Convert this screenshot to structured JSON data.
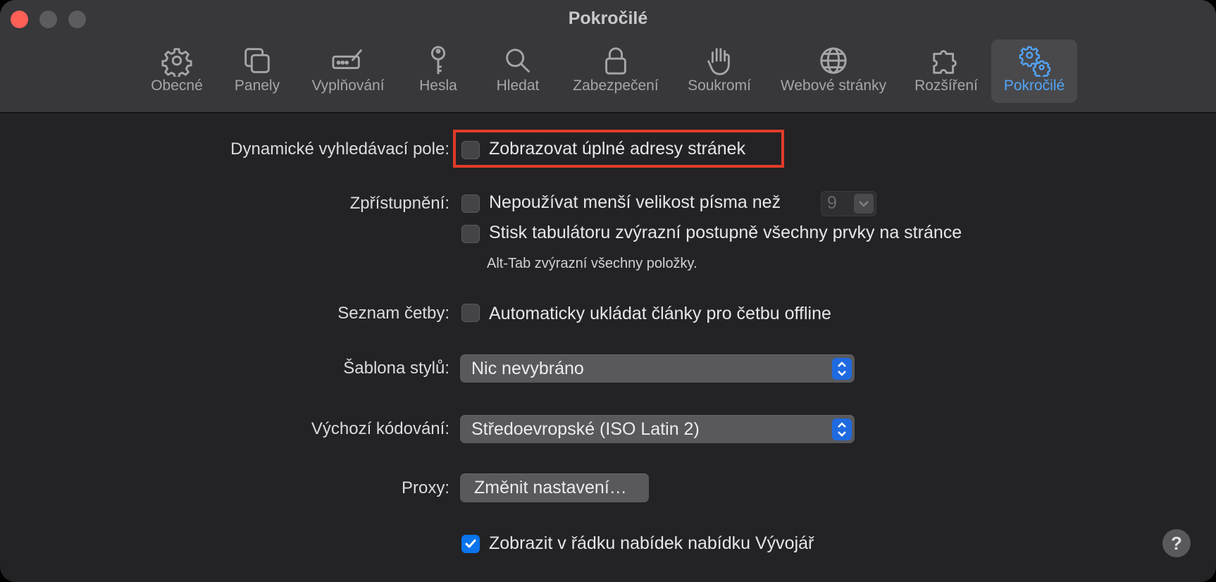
{
  "window": {
    "title": "Pokročilé",
    "accent_color": "#53a4f8",
    "highlight_color": "#e03c28"
  },
  "toolbar": {
    "items": [
      {
        "label": "Obecné",
        "icon": "gear-icon"
      },
      {
        "label": "Panely",
        "icon": "tabs-icon"
      },
      {
        "label": "Vyplňování",
        "icon": "autofill-icon"
      },
      {
        "label": "Hesla",
        "icon": "key-icon"
      },
      {
        "label": "Hledat",
        "icon": "search-icon"
      },
      {
        "label": "Zabezpečení",
        "icon": "lock-icon"
      },
      {
        "label": "Soukromí",
        "icon": "hand-icon"
      },
      {
        "label": "Webové stránky",
        "icon": "globe-icon"
      },
      {
        "label": "Rozšíření",
        "icon": "puzzle-icon"
      },
      {
        "label": "Pokročilé",
        "icon": "gears-icon",
        "selected": true
      }
    ]
  },
  "settings": {
    "smart_search": {
      "label": "Dynamické vyhledávací pole:",
      "option": "Zobrazovat úplné adresy stránek",
      "checked": false
    },
    "accessibility": {
      "label": "Zpřístupnění:",
      "min_font_option": "Nepoužívat menší velikost písma než",
      "min_font_checked": false,
      "min_font_value": "9",
      "tab_option": "Stisk tabulátoru zvýrazní postupně všechny prvky na stránce",
      "tab_checked": false,
      "tab_hint": "Alt-Tab zvýrazní všechny položky."
    },
    "reading_list": {
      "label": "Seznam četby:",
      "option": "Automaticky ukládat články pro četbu offline",
      "checked": false
    },
    "style_sheet": {
      "label": "Šablona stylů:",
      "value": "Nic nevybráno"
    },
    "default_encoding": {
      "label": "Výchozí kódování:",
      "value": "Středoevropské (ISO Latin 2)"
    },
    "proxies": {
      "label": "Proxy:",
      "button": "Změnit nastavení…"
    },
    "develop_menu": {
      "option": "Zobrazit v řádku nabídek nabídku Vývojář",
      "checked": true
    }
  },
  "help": {
    "label": "?"
  }
}
